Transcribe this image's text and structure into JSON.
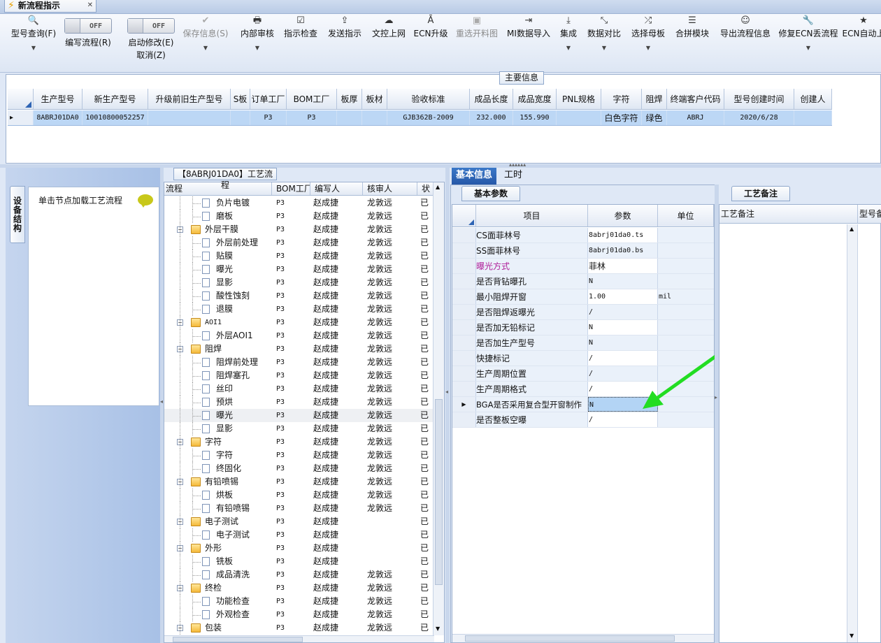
{
  "window": {
    "tab_title": "新流程指示",
    "close_glyph": "✕"
  },
  "toolbar": {
    "items": [
      {
        "label": "型号查询(F)",
        "icon": "🔍",
        "name": "model-query"
      },
      {
        "label": "编写流程(R)",
        "toggle": "OFF",
        "name": "write-flow"
      },
      {
        "label": "启动修改(E)",
        "label2": "取消(Z)",
        "toggle": "OFF",
        "name": "start-modify"
      },
      {
        "label": "保存信息(S)",
        "icon": "✔",
        "disabled": true,
        "name": "save-info"
      },
      {
        "label": "内部审核",
        "icon": "🖶",
        "name": "internal-review"
      },
      {
        "label": "指示检查",
        "icon": "☑",
        "name": "instruction-check"
      },
      {
        "label": "发送指示",
        "icon": "⇪",
        "name": "send-instruction"
      },
      {
        "label": "文控上网",
        "icon": "☁",
        "name": "doc-online"
      },
      {
        "label": "ECN升级",
        "icon": "Ā",
        "name": "ecn-upgrade"
      },
      {
        "label": "重选开料图",
        "icon": "▣",
        "disabled": true,
        "name": "reselect-cutting"
      },
      {
        "label": "MI数据导入",
        "icon": "⇥",
        "name": "mi-import"
      },
      {
        "label": "集成",
        "icon": "⤓",
        "name": "integrate"
      },
      {
        "label": "数据对比",
        "icon": "⤡",
        "name": "data-compare"
      },
      {
        "label": "选择母板",
        "icon": "⤮",
        "name": "select-mother"
      },
      {
        "label": "合拼模块",
        "icon": "☰",
        "name": "merge-module"
      },
      {
        "label": "导出流程信息",
        "icon": "☺",
        "name": "export-flow"
      },
      {
        "label": "修复ECN丢流程",
        "icon": "🔧",
        "name": "fix-ecn"
      },
      {
        "label": "ECN自动上",
        "icon": "★",
        "name": "ecn-auto"
      }
    ]
  },
  "main_info": {
    "label": "主要信息",
    "columns": [
      "生产型号",
      "新生产型号",
      "升级前旧生产型号",
      "S板",
      "订单工厂",
      "BOM工厂",
      "板厚",
      "板材",
      "验收标准",
      "成品长度",
      "成品宽度",
      "PNL规格",
      "字符",
      "阻焊",
      "终端客户代码",
      "型号创建时间",
      "创建人"
    ],
    "row": [
      "8ABRJ01DA0",
      "10010800052257",
      "",
      "",
      "P3",
      "P3",
      "",
      "",
      "GJB362B-2009",
      "232.000",
      "155.990",
      "",
      "白色字符",
      "绿色",
      "ABRJ",
      "2020/6/28",
      ""
    ]
  },
  "left": {
    "vtab": "设备结构",
    "hint": "单击节点加载工艺流程"
  },
  "tree": {
    "label": "【8ABRJ01DA0】工艺流程",
    "columns": [
      "流程",
      "BOM工厂",
      "编写人",
      "核审人",
      "状"
    ],
    "rows": [
      {
        "l": 2,
        "t": "负片电镀",
        "b": "P3",
        "w": "赵成捷",
        "r": "龙敦远",
        "s": "已"
      },
      {
        "l": 2,
        "t": "磨板",
        "b": "P3",
        "w": "赵成捷",
        "r": "龙敦远",
        "s": "已"
      },
      {
        "l": 1,
        "t": "外层干膜",
        "b": "P3",
        "w": "赵成捷",
        "r": "龙敦远",
        "s": "已"
      },
      {
        "l": 2,
        "t": "外层前处理",
        "b": "P3",
        "w": "赵成捷",
        "r": "龙敦远",
        "s": "已"
      },
      {
        "l": 2,
        "t": "贴膜",
        "b": "P3",
        "w": "赵成捷",
        "r": "龙敦远",
        "s": "已"
      },
      {
        "l": 2,
        "t": "曝光",
        "b": "P3",
        "w": "赵成捷",
        "r": "龙敦远",
        "s": "已"
      },
      {
        "l": 2,
        "t": "显影",
        "b": "P3",
        "w": "赵成捷",
        "r": "龙敦远",
        "s": "已"
      },
      {
        "l": 2,
        "t": "酸性蚀刻",
        "b": "P3",
        "w": "赵成捷",
        "r": "龙敦远",
        "s": "已"
      },
      {
        "l": 2,
        "t": "退膜",
        "b": "P3",
        "w": "赵成捷",
        "r": "龙敦远",
        "s": "已"
      },
      {
        "l": 1,
        "t": "AOI1",
        "b": "P3",
        "w": "赵成捷",
        "r": "龙敦远",
        "s": "已"
      },
      {
        "l": 2,
        "t": "外层AOI1",
        "b": "P3",
        "w": "赵成捷",
        "r": "龙敦远",
        "s": "已"
      },
      {
        "l": 1,
        "t": "阻焊",
        "b": "P3",
        "w": "赵成捷",
        "r": "龙敦远",
        "s": "已"
      },
      {
        "l": 2,
        "t": "阻焊前处理",
        "b": "P3",
        "w": "赵成捷",
        "r": "龙敦远",
        "s": "已"
      },
      {
        "l": 2,
        "t": "阻焊塞孔",
        "b": "P3",
        "w": "赵成捷",
        "r": "龙敦远",
        "s": "已"
      },
      {
        "l": 2,
        "t": "丝印",
        "b": "P3",
        "w": "赵成捷",
        "r": "龙敦远",
        "s": "已"
      },
      {
        "l": 2,
        "t": "预烘",
        "b": "P3",
        "w": "赵成捷",
        "r": "龙敦远",
        "s": "已"
      },
      {
        "l": 2,
        "t": "曝光",
        "b": "P3",
        "w": "赵成捷",
        "r": "龙敦远",
        "s": "已",
        "sel": true
      },
      {
        "l": 2,
        "t": "显影",
        "b": "P3",
        "w": "赵成捷",
        "r": "龙敦远",
        "s": "已"
      },
      {
        "l": 1,
        "t": "字符",
        "b": "P3",
        "w": "赵成捷",
        "r": "龙敦远",
        "s": "已"
      },
      {
        "l": 2,
        "t": "字符",
        "b": "P3",
        "w": "赵成捷",
        "r": "龙敦远",
        "s": "已"
      },
      {
        "l": 2,
        "t": "终固化",
        "b": "P3",
        "w": "赵成捷",
        "r": "龙敦远",
        "s": "已"
      },
      {
        "l": 1,
        "t": "有铅喷锡",
        "b": "P3",
        "w": "赵成捷",
        "r": "龙敦远",
        "s": "已"
      },
      {
        "l": 2,
        "t": "烘板",
        "b": "P3",
        "w": "赵成捷",
        "r": "龙敦远",
        "s": "已"
      },
      {
        "l": 2,
        "t": "有铅喷锡",
        "b": "P3",
        "w": "赵成捷",
        "r": "龙敦远",
        "s": "已"
      },
      {
        "l": 1,
        "t": "电子测试",
        "b": "P3",
        "w": "赵成捷",
        "r": "",
        "s": "已"
      },
      {
        "l": 2,
        "t": "电子测试",
        "b": "P3",
        "w": "赵成捷",
        "r": "",
        "s": "已"
      },
      {
        "l": 1,
        "t": "外形",
        "b": "P3",
        "w": "赵成捷",
        "r": "",
        "s": "已"
      },
      {
        "l": 2,
        "t": "铣板",
        "b": "P3",
        "w": "赵成捷",
        "r": "",
        "s": "已"
      },
      {
        "l": 2,
        "t": "成品清洗",
        "b": "P3",
        "w": "赵成捷",
        "r": "龙敦远",
        "s": "已"
      },
      {
        "l": 1,
        "t": "终检",
        "b": "P3",
        "w": "赵成捷",
        "r": "龙敦远",
        "s": "已"
      },
      {
        "l": 2,
        "t": "功能检查",
        "b": "P3",
        "w": "赵成捷",
        "r": "龙敦远",
        "s": "已"
      },
      {
        "l": 2,
        "t": "外观检查",
        "b": "P3",
        "w": "赵成捷",
        "r": "龙敦远",
        "s": "已"
      },
      {
        "l": 1,
        "t": "包装",
        "b": "P3",
        "w": "赵成捷",
        "r": "龙敦远",
        "s": "已"
      }
    ]
  },
  "right": {
    "tabs": [
      "基本信息",
      "工时"
    ],
    "subtab": "基本参数",
    "columns": [
      "项目",
      "参数",
      "单位"
    ],
    "params": [
      {
        "n": "CS面菲林号",
        "v": "8abrj01da0.ts",
        "u": "",
        "mono": true
      },
      {
        "n": "SS面菲林号",
        "v": "8abrj01da0.bs",
        "u": "",
        "mono": true
      },
      {
        "n": "曝光方式",
        "v": "菲林",
        "u": "",
        "pink": true
      },
      {
        "n": "是否背钻曝孔",
        "v": "N",
        "u": ""
      },
      {
        "n": "最小阻焊开窗",
        "v": "1.00",
        "u": "mil"
      },
      {
        "n": "是否阻焊返曝光",
        "v": "/",
        "u": ""
      },
      {
        "n": "是否加无铅标记",
        "v": "N",
        "u": ""
      },
      {
        "n": "是否加生产型号",
        "v": "N",
        "u": ""
      },
      {
        "n": "快捷标记",
        "v": "/",
        "u": ""
      },
      {
        "n": "生产周期位置",
        "v": "/",
        "u": ""
      },
      {
        "n": "生产周期格式",
        "v": "/",
        "u": ""
      },
      {
        "n": "BGA是否采用复合型开窗制作",
        "v": "N",
        "u": "",
        "current": true
      },
      {
        "n": "是否整板空曝",
        "v": "/",
        "u": ""
      }
    ],
    "remark_tab": "工艺备注",
    "remark_columns": [
      "工艺备注",
      "型号备"
    ]
  },
  "colors": {
    "accent_arrow": "#22dd22",
    "selected_row": "#bcd7f5",
    "tab_active": "#2e64b4"
  }
}
